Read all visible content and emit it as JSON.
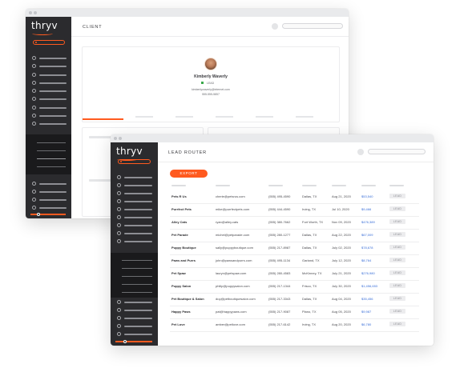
{
  "client_window": {
    "logo_text": "thryv",
    "page_title": "CLIENT",
    "contact": {
      "name": "Kimberly Waverly",
      "tag": "LEAD",
      "email": "kimberlywaverly@internet.com",
      "phone": "555-555-5857"
    }
  },
  "lead_window": {
    "logo_text": "thryv",
    "page_title": "LEAD ROUTER",
    "export_label": "EXPORT",
    "rows": [
      {
        "name": "Pets R Us",
        "email": "cherie@petsrus.com",
        "phone": "(555) 495-4590",
        "location": "Dallas, TX",
        "date": "Aug 21, 2020",
        "amount": "$53,540",
        "status": "LEAD"
      },
      {
        "name": "Purrfect Pets",
        "email": "mike@purrfectpets.com",
        "phone": "(555) 444-4590",
        "location": "Irving, TX",
        "date": "Jul 10, 2020",
        "amount": "$9,466",
        "status": "LEAD"
      },
      {
        "name": "Alley Cats",
        "email": "ryan@alley.cats",
        "phone": "(555) 380-7662",
        "location": "Fort Worth, TX",
        "date": "Nov 09, 2020",
        "amount": "$476,389",
        "status": "LEAD"
      },
      {
        "name": "Pet Parade",
        "email": "michel@petparade.com",
        "phone": "(555) 280-1277",
        "location": "Dallas, TX",
        "date": "Aug 22, 2020",
        "amount": "$67,009",
        "status": "LEAD"
      },
      {
        "name": "Puppy Boutique",
        "email": "sally@puppyboutique.com",
        "phone": "(555) 217-8987",
        "location": "Dallas, TX",
        "date": "July 02, 2020",
        "amount": "$78,678",
        "status": "LEAD"
      },
      {
        "name": "Paws and Purrs",
        "email": "john@pawsandpurrs.com",
        "phone": "(555) 495-1134",
        "location": "Garland, TX",
        "date": "July 12, 2020",
        "amount": "$8,764",
        "status": "LEAD"
      },
      {
        "name": "Pet Spaw",
        "email": "lauryn@petspaw.com",
        "phone": "(555) 280-4583",
        "location": "McKinney, TX",
        "date": "July 21, 2020",
        "amount": "$276,980",
        "status": "LEAD"
      },
      {
        "name": "Puppy Salon",
        "email": "philip@puppysalon.com",
        "phone": "(555) 217-1344",
        "location": "Frisco, TX",
        "date": "July 30, 2020",
        "amount": "$1,456,653",
        "status": "LEAD"
      },
      {
        "name": "Pet Boutique & Salon",
        "email": "duy@petboutiquesalon.com",
        "phone": "(555) 217-3343",
        "location": "Dallas, TX",
        "date": "Aug 04, 2020",
        "amount": "$35,456",
        "status": "LEAD"
      },
      {
        "name": "Happy Paws",
        "email": "pat@happypaws.com",
        "phone": "(555) 217-9087",
        "location": "Plano, TX",
        "date": "Aug 05, 2020",
        "amount": "$9,987",
        "status": "LEAD"
      },
      {
        "name": "Pet Love",
        "email": "amber@petlove.com",
        "phone": "(555) 217-6142",
        "location": "Irving, TX",
        "date": "Aug 20, 2020",
        "amount": "$6,780",
        "status": "LEAD"
      }
    ]
  },
  "colors": {
    "accent": "#ff5a1f",
    "sidebar": "#2b2b2e",
    "link": "#3a6fd8",
    "flag": "#39a84a"
  }
}
